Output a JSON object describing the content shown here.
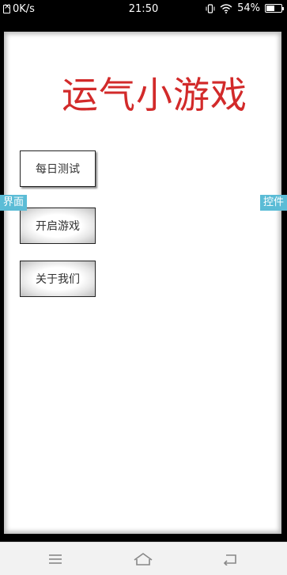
{
  "status_bar": {
    "net_speed": "0K/s",
    "time": "21:50",
    "battery_percent": "54%",
    "battery_level": 0.54
  },
  "app": {
    "title": "运气小游戏",
    "title_color": "#d22a2a",
    "buttons": {
      "daily_test": "每日测试",
      "start_game": "开启游戏",
      "about_us": "关于我们"
    },
    "side_tabs": {
      "left": "界面",
      "right": "控件"
    },
    "tab_color": "#5bbcd6"
  },
  "nav_bar": {
    "icons": [
      "menu-icon",
      "home-icon",
      "back-icon"
    ]
  }
}
